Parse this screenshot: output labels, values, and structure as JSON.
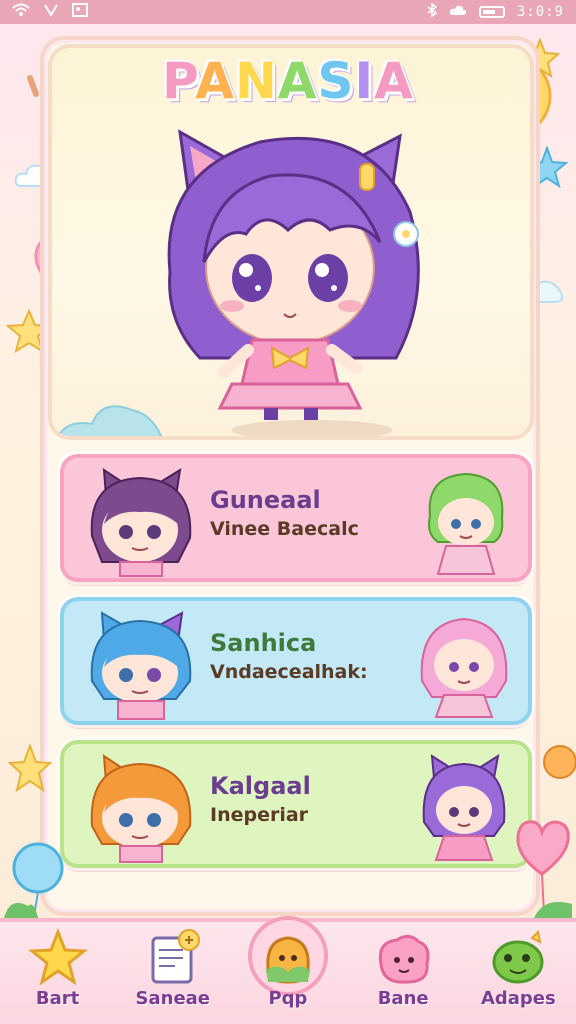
{
  "status_bar": {
    "time": "3:0:9",
    "icons": [
      "wifi-icon",
      "signal-icon",
      "image-icon",
      "bluetooth-icon",
      "cloud-icon",
      "battery-icon"
    ]
  },
  "app": {
    "title_letters": [
      "P",
      "A",
      "N",
      "A",
      "S",
      "I",
      "A"
    ]
  },
  "cards": [
    {
      "title": "Guneaal",
      "subtitle": "Vinee Baecalc",
      "color": "#fcc6d9"
    },
    {
      "title": "Sanhica",
      "subtitle": "Vndaecealhak:",
      "color": "#c3e9f7"
    },
    {
      "title": "Kalgaal",
      "subtitle": "Ineperiar",
      "color": "#dff5bf"
    }
  ],
  "nav": [
    {
      "label": "Bart",
      "icon": "star-icon"
    },
    {
      "label": "Saneae",
      "icon": "document-icon"
    },
    {
      "label": "Pqp",
      "icon": "blob-icon",
      "active": true
    },
    {
      "label": "Bane",
      "icon": "pink-blob-icon"
    },
    {
      "label": "Adapes",
      "icon": "frog-icon"
    }
  ],
  "colors": {
    "accent_pink": "#f49fbc",
    "accent_purple": "#7b3d93",
    "background": "#fde7ef"
  }
}
